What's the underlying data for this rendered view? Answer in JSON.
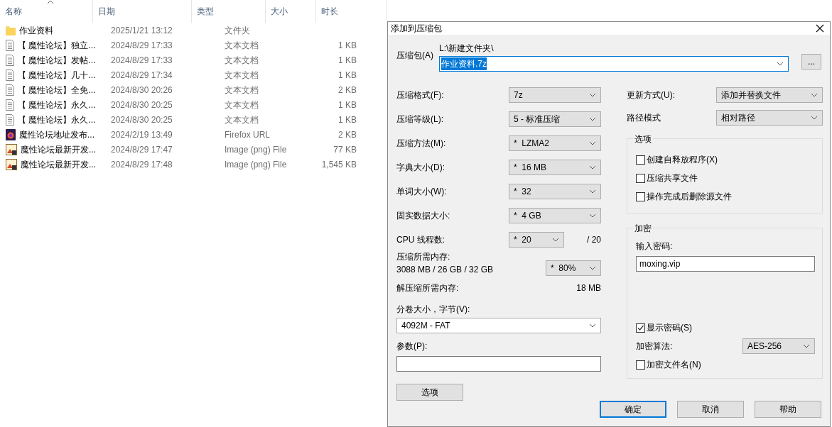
{
  "explorer": {
    "columns": [
      {
        "label": "名称",
        "sorted": true
      },
      {
        "label": "日期",
        "sorted": false
      },
      {
        "label": "类型",
        "sorted": false
      },
      {
        "label": "大小",
        "sorted": false
      },
      {
        "label": "时长",
        "sorted": false
      }
    ],
    "rows": [
      {
        "kind": "folder",
        "name": "作业资料",
        "date": "2025/1/21 13:12",
        "type": "文件夹"
      },
      {
        "kind": "text",
        "name": "【 魔性论坛】独立...",
        "date": "2024/8/29 17:33",
        "type": "文本文档",
        "size": "1 KB"
      },
      {
        "kind": "text",
        "name": "【 魔性论坛】发帖...",
        "date": "2024/8/29 17:33",
        "type": "文本文档",
        "size": "1 KB"
      },
      {
        "kind": "text",
        "name": "【 魔性论坛】几十...",
        "date": "2024/8/29 17:34",
        "type": "文本文档",
        "size": "1 KB"
      },
      {
        "kind": "text",
        "name": "【 魔性论坛】全免...",
        "date": "2024/8/30 20:26",
        "type": "文本文档",
        "size": "2 KB"
      },
      {
        "kind": "text",
        "name": "【 魔性论坛】永久...",
        "date": "2024/8/30 20:25",
        "type": "文本文档",
        "size": "1 KB"
      },
      {
        "kind": "text",
        "name": "【 魔性论坛】永久...",
        "date": "2024/8/30 20:25",
        "type": "文本文档",
        "size": "1 KB"
      },
      {
        "kind": "url",
        "name": "魔性论坛地址发布...",
        "date": "2024/2/19 13:49",
        "type": "Firefox URL",
        "size": "2 KB"
      },
      {
        "kind": "image",
        "name": "魔性论坛最新开发...",
        "date": "2024/8/29 17:47",
        "type": "Image (png) File",
        "size": "77 KB"
      },
      {
        "kind": "image",
        "name": "魔性论坛最新开发...",
        "date": "2024/8/29 17:48",
        "type": "Image (png) File",
        "size": "1,545 KB"
      }
    ]
  },
  "dialog": {
    "title": "添加到压缩包",
    "archive": {
      "label": "压缩包(A)",
      "path": "L:\\新建文件夹\\",
      "value": "作业资料.7z",
      "browse": "..."
    },
    "left_fields": [
      {
        "kind": "select",
        "label": "压缩格式(F):",
        "value": "7z"
      },
      {
        "kind": "select",
        "label": "压缩等级(L):",
        "value": "5 - 标准压缩"
      },
      {
        "kind": "select",
        "label": "压缩方法(M):",
        "value": "*  LZMA2"
      },
      {
        "kind": "select",
        "label": "字典大小(D):",
        "value": "*  16 MB"
      },
      {
        "kind": "select",
        "label": "单词大小(W):",
        "value": "*  32"
      },
      {
        "kind": "select",
        "label": "固实数据大小:",
        "value": "*  4 GB"
      },
      {
        "kind": "threads",
        "label": "CPU 线程数:",
        "value": "*  20",
        "suffix": "/ 20"
      },
      {
        "kind": "memory",
        "label": "压缩所需内存:",
        "detail": "3088 MB / 26 GB / 32 GB",
        "value": "*  80%"
      },
      {
        "kind": "reading",
        "label": "解压缩所需内存:",
        "value": "18 MB"
      },
      {
        "kind": "wide-select",
        "label": "分卷大小，字节(V):",
        "value": "4092M - FAT"
      },
      {
        "kind": "wide-text",
        "label": "参数(P):"
      }
    ],
    "options_button": "选项",
    "right_fields": [
      {
        "label": "更新方式(U):",
        "value": "添加并替换文件"
      },
      {
        "label": "路径模式",
        "value": "相对路径"
      }
    ],
    "options_group": {
      "title": "选项",
      "checkboxes": [
        {
          "label": "创建自释放程序(X)",
          "checked": false
        },
        {
          "label": "压缩共享文件",
          "checked": false
        },
        {
          "label": "操作完成后删除源文件",
          "checked": false
        }
      ]
    },
    "encryption": {
      "title": "加密",
      "password_label": "输入密码:",
      "password": "moxing.vip",
      "show_password": {
        "label": "显示密码(S)",
        "checked": true
      },
      "method_label": "加密算法:",
      "method": "AES-256",
      "encrypt_names": {
        "label": "加密文件名(N)",
        "checked": false
      }
    },
    "buttons": [
      {
        "label": "确定",
        "default": true
      },
      {
        "label": "取消",
        "default": false
      },
      {
        "label": "帮助",
        "default": false
      }
    ]
  }
}
